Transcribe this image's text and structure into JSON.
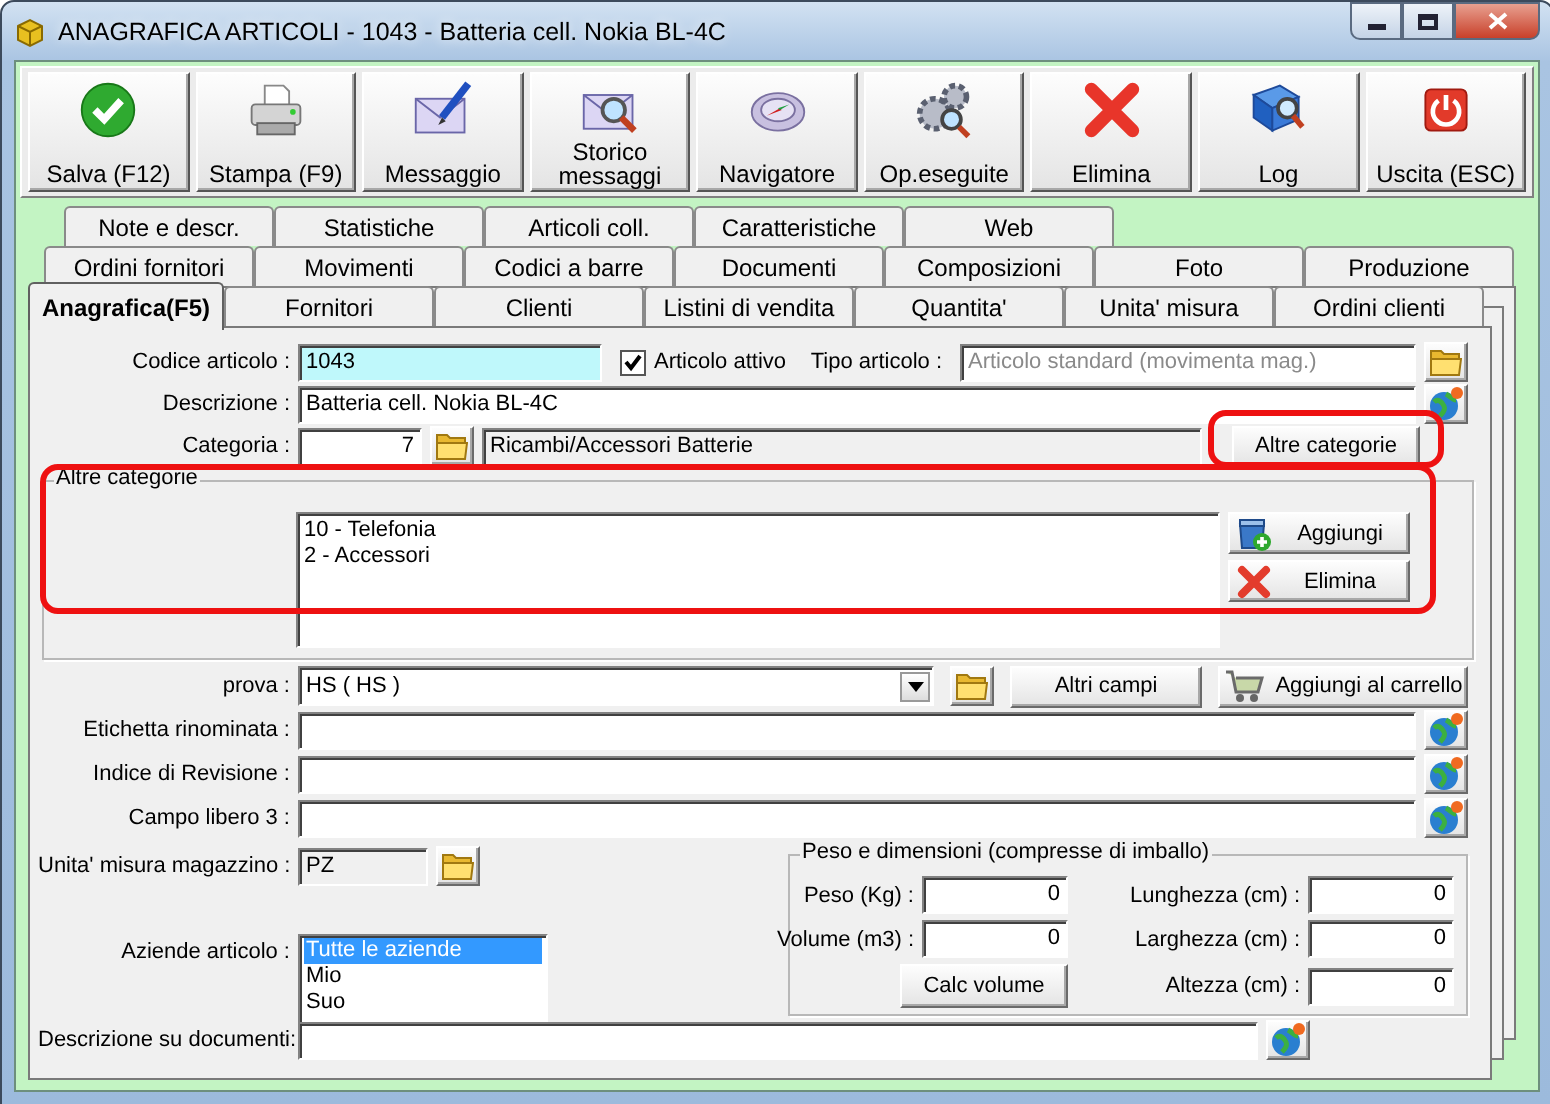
{
  "window": {
    "title": "ANAGRAFICA ARTICOLI - 1043 - Batteria cell. Nokia BL-4C"
  },
  "toolbar": [
    "Salva (F12)",
    "Stampa (F9)",
    "Messaggio",
    "Storico messaggi",
    "Navigatore",
    "Op.eseguite",
    "Elimina",
    "Log",
    "Uscita (ESC)"
  ],
  "tab_rows": [
    [
      {
        "label": "Note e descr.",
        "selected": false
      },
      {
        "label": "Statistiche",
        "selected": false
      },
      {
        "label": "Articoli coll.",
        "selected": false
      },
      {
        "label": "Caratteristiche",
        "selected": false
      },
      {
        "label": "Web",
        "selected": false
      }
    ],
    [
      {
        "label": "Ordini fornitori",
        "selected": false
      },
      {
        "label": "Movimenti",
        "selected": false
      },
      {
        "label": "Codici a barre",
        "selected": false
      },
      {
        "label": "Documenti",
        "selected": false
      },
      {
        "label": "Composizioni",
        "selected": false
      },
      {
        "label": "Foto",
        "selected": false
      },
      {
        "label": "Produzione",
        "selected": false
      }
    ],
    [
      {
        "label": "Anagrafica(F5)",
        "selected": true
      },
      {
        "label": "Fornitori",
        "selected": false
      },
      {
        "label": "Clienti",
        "selected": false
      },
      {
        "label": "Listini di vendita",
        "selected": false
      },
      {
        "label": "Quantita'",
        "selected": false
      },
      {
        "label": "Unita' misura",
        "selected": false
      },
      {
        "label": "Ordini clienti",
        "selected": false
      }
    ]
  ],
  "form": {
    "codice_articolo": {
      "label": "Codice articolo :",
      "value": "1043",
      "focused": true
    },
    "articolo_attivo": {
      "label": "Articolo attivo",
      "checked": true
    },
    "tipo_articolo": {
      "label": "Tipo articolo :",
      "value": "Articolo standard (movimenta mag.)",
      "disabled": true
    },
    "descrizione": {
      "label": "Descrizione :",
      "value": "Batteria cell. Nokia BL-4C"
    },
    "categoria": {
      "label": "Categoria :",
      "code": "7",
      "name": "Ricambi/Accessori Batterie",
      "readonly": true
    },
    "altre_categorie_button": "Altre categorie",
    "altre_categorie": {
      "title": "Altre categorie",
      "items": [
        "10 - Telefonia",
        "2 - Accessori"
      ],
      "buttons": [
        "Aggiungi",
        "Elimina"
      ]
    },
    "prova": {
      "label": "prova :",
      "value": "HS ( HS )"
    },
    "altri_campi_button": "Altri campi",
    "carrello_button": "Aggiungi al carrello",
    "extra_fields": [
      {
        "label": "Etichetta rinominata :"
      },
      {
        "label": "Indice di Revisione :"
      },
      {
        "label": "Campo libero 3 :"
      }
    ],
    "unita_misura": {
      "label": "Unita' misura magazzino :",
      "value": "PZ",
      "readonly": true
    },
    "aziende": {
      "label": "Aziende articolo :",
      "items": [
        {
          "label": "Tutte le aziende",
          "selected": true
        },
        {
          "label": "Mio",
          "selected": false
        },
        {
          "label": "Suo",
          "selected": false
        }
      ]
    },
    "peso_dimensioni": {
      "title": "Peso e dimensioni (compresse di imballo)",
      "fields": [
        {
          "label": "Peso (Kg) :",
          "value": "0"
        },
        {
          "label": "Lunghezza (cm) :",
          "value": "0"
        },
        {
          "label": "Volume (m3) :",
          "value": "0"
        },
        {
          "label": "Larghezza (cm) :",
          "value": "0"
        },
        {
          "label": "Altezza (cm) :",
          "value": "0"
        }
      ],
      "calc_button": "Calc volume"
    },
    "descrizione_documenti": {
      "label": "Descrizione su documenti:"
    }
  }
}
